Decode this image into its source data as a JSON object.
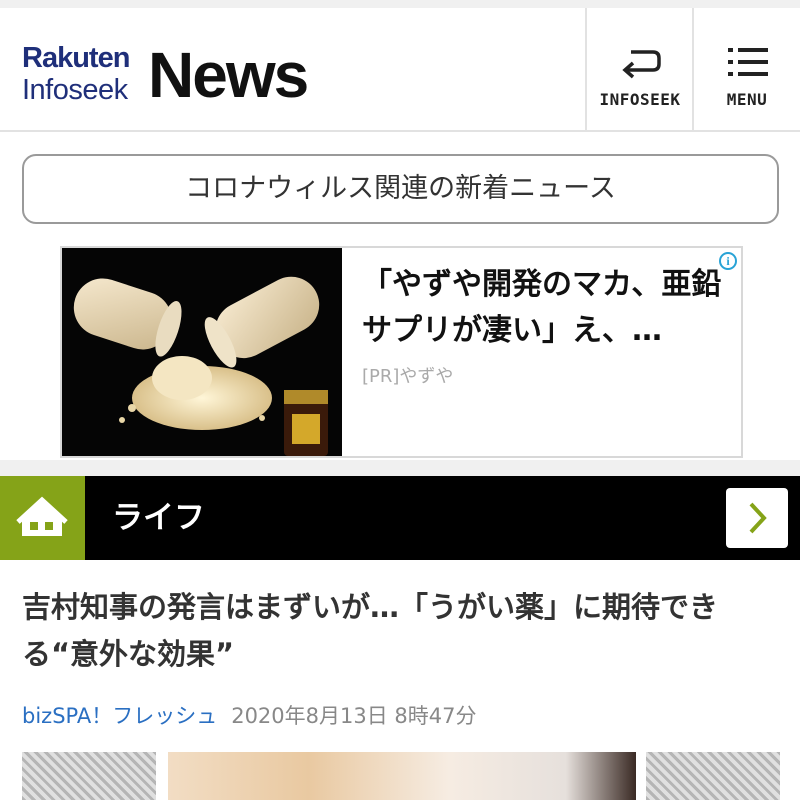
{
  "header": {
    "logo_top": "Rakuten",
    "logo_bottom": "Infoseek",
    "logo_main": "News",
    "infoseek_label": "INFOSEEK",
    "menu_label": "MENU"
  },
  "corona_link": "コロナウィルス関連の新着ニュース",
  "ad": {
    "title": "「やずや開発のマカ、亜鉛サプリが凄い」え、…",
    "sponsor": "[PR]やずや",
    "info_glyph": "i"
  },
  "category": {
    "label": "ライフ",
    "accent": "#85a318"
  },
  "article": {
    "title": "吉村知事の発言はまずいが…「うがい薬」に期待できる“意外な効果”",
    "source": "bizSPA！フレッシュ",
    "date": "2020年8月13日 8時47分"
  },
  "icons": {
    "back": "return-arrow-icon",
    "menu": "hamburger-list-icon",
    "home": "house-icon",
    "next": "chevron-right-icon"
  }
}
